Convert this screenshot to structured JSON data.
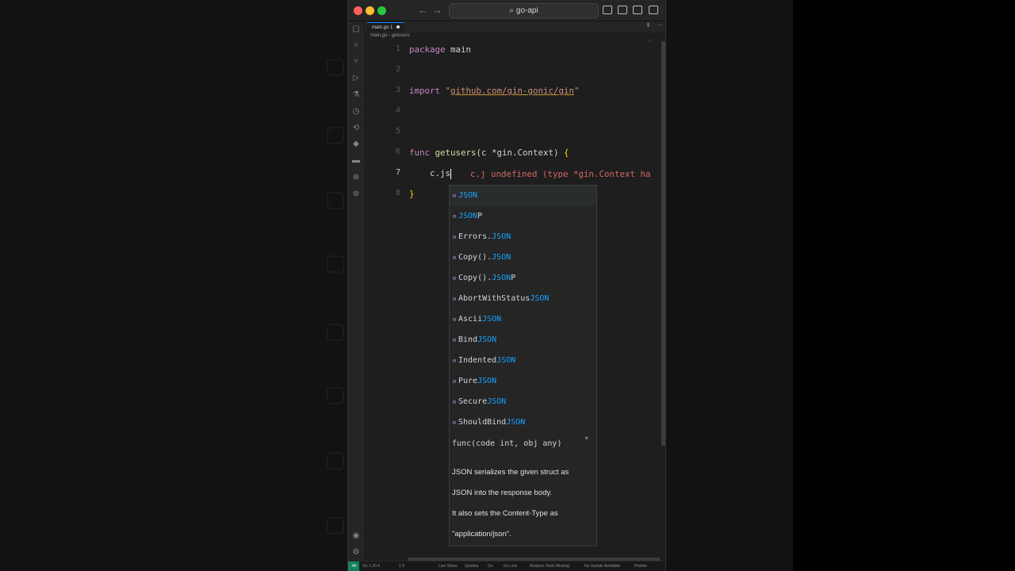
{
  "window": {
    "title": "go-api"
  },
  "tab": {
    "label": "main.go 1"
  },
  "breadcrumbs": {
    "file": "main.go",
    "symbol": "getusers"
  },
  "code": {
    "line_numbers": [
      "1",
      "2",
      "3",
      "4",
      "5",
      "6",
      "7",
      "8"
    ],
    "l1_kw": "package",
    "l1_rest": " main",
    "l3_kw": "import",
    "l3_q1": " \"",
    "l3_str": "github.com/gin-gonic/gin",
    "l3_q2": "\"",
    "l6_kw": "func",
    "l6_fn": " getusers",
    "l6_rest": "(c *gin.Context) ",
    "l6_brace": "{",
    "l7_text": "    c.js",
    "l8_brace": "}"
  },
  "error_hint": "c.j undefined (type *gin.Context ha",
  "suggestions": [
    {
      "pre": "",
      "match": "JSON",
      "post": ""
    },
    {
      "pre": "",
      "match": "JSON",
      "post": "P"
    },
    {
      "pre": "Errors.",
      "match": "JSON",
      "post": ""
    },
    {
      "pre": "Copy().",
      "match": "JSON",
      "post": ""
    },
    {
      "pre": "Copy().",
      "match": "JSON",
      "post": "P"
    },
    {
      "pre": "AbortWithStatus",
      "match": "JSON",
      "post": ""
    },
    {
      "pre": "Ascii",
      "match": "JSON",
      "post": ""
    },
    {
      "pre": "Bind",
      "match": "JSON",
      "post": ""
    },
    {
      "pre": "Indented",
      "match": "JSON",
      "post": ""
    },
    {
      "pre": "Pure",
      "match": "JSON",
      "post": ""
    },
    {
      "pre": "Secure",
      "match": "JSON",
      "post": ""
    },
    {
      "pre": "ShouldBind",
      "match": "JSON",
      "post": ""
    }
  ],
  "docs": {
    "signature": "func(code int, obj any)",
    "close": "×",
    "lines": [
      "JSON serializes the given struct as",
      "JSON into the response body.",
      "It also sets the Content-Type as",
      "\"application/json\"."
    ]
  },
  "statusbar": {
    "go_version": "Go 1.20.4",
    "problems": "1 0",
    "live_share": "Live Share",
    "quokka": "Quokka",
    "go": "Go",
    "go_live": "Go Live",
    "analysis": "Analysis Tools Missing",
    "updates": "No Update Available",
    "prettier": "Prettier"
  },
  "colors": {
    "accent": "#0a84ff",
    "error": "#d46863",
    "match": "#18a3ff",
    "keyword": "#c586c0",
    "function": "#dcdcaa",
    "string": "#ce9178"
  },
  "icons": [
    "search-icon",
    "explorer-icon",
    "source-control-icon",
    "run-debug-icon",
    "testing-icon",
    "extensions-icon",
    "remote-icon",
    "docker-icon",
    "accounts-icon",
    "settings-icon",
    "close-icon",
    "layout-icon"
  ]
}
